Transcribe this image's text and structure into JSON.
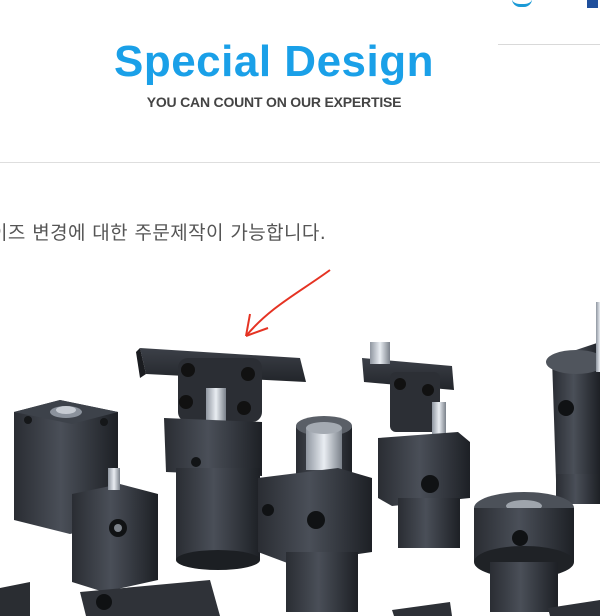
{
  "header": {
    "title": "Special Design",
    "subtitle": "YOU CAN COUNT ON OUR EXPERTISE"
  },
  "content": {
    "description": "이즈 변경에 대한 주문제작이 가능합니다."
  },
  "image": {
    "icon": "hydraulic-clamp-products-photo",
    "annotation_color": "#e53323"
  },
  "colors": {
    "title": "#1aa0e8",
    "topbar_accent": "#1f4f9c"
  }
}
